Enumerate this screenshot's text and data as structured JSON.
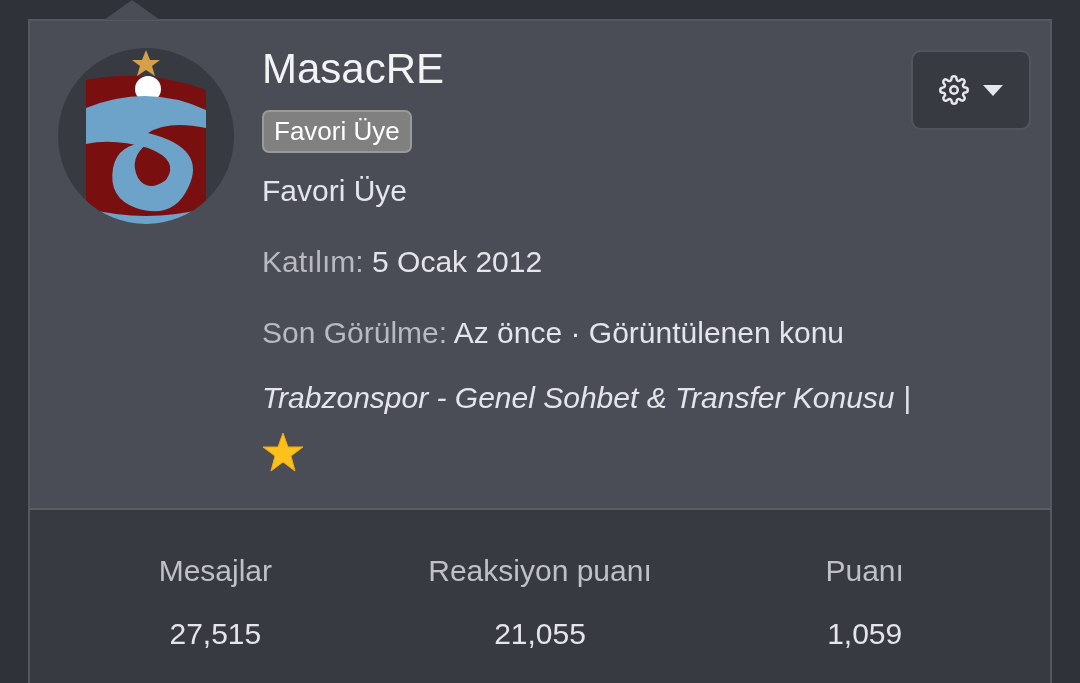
{
  "user": {
    "name": "MasacRE",
    "badge": "Favori Üye",
    "title": "Favori Üye",
    "joined": {
      "label": "Katılım:",
      "value": "5 Ocak 2012"
    },
    "last_seen": {
      "label": "Son Görülme:",
      "value": "Az önce · Görüntülenen konu",
      "thread": "Trabzonspor - Genel Sohbet & Transfer Konusu |"
    }
  },
  "stats": [
    {
      "label": "Mesajlar",
      "value": "27,515"
    },
    {
      "label": "Reaksiyon puanı",
      "value": "21,055"
    },
    {
      "label": "Puanı",
      "value": "1,059"
    }
  ]
}
